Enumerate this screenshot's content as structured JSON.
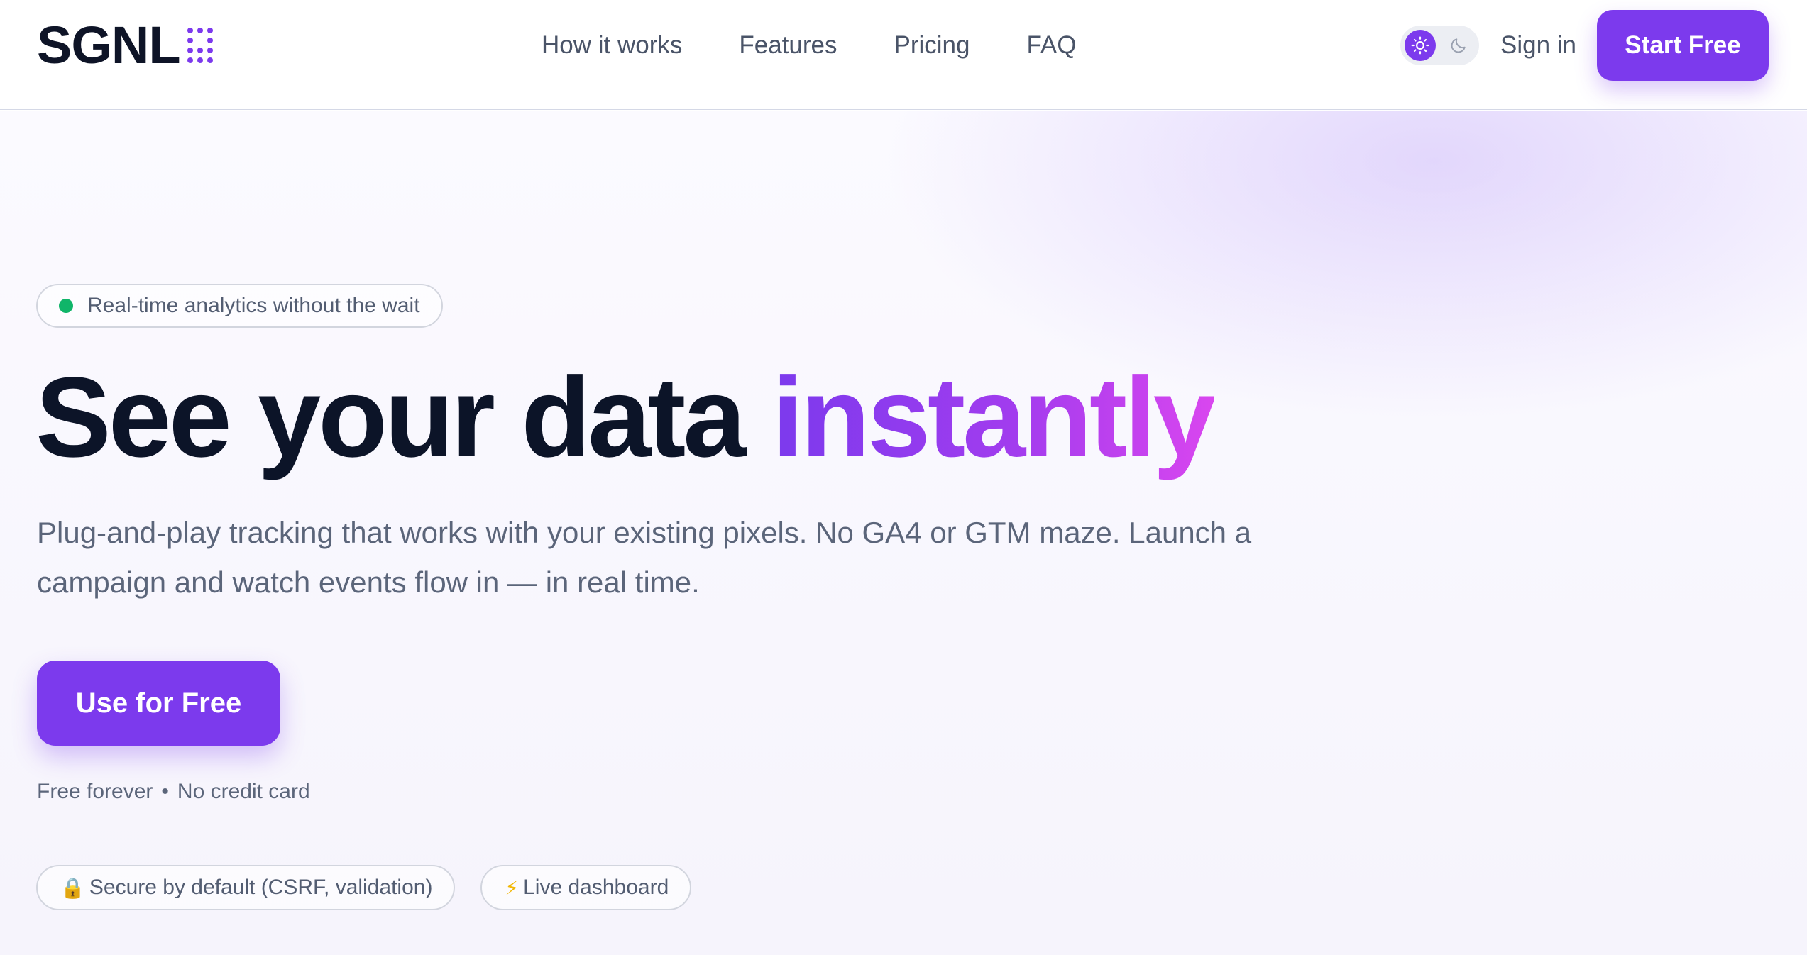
{
  "header": {
    "logo_text": "SGNL",
    "nav": [
      {
        "label": "How it works"
      },
      {
        "label": "Features"
      },
      {
        "label": "Pricing"
      },
      {
        "label": "FAQ"
      }
    ],
    "theme_toggle": {
      "active": "light",
      "icons": [
        "sun-icon",
        "moon-icon"
      ]
    },
    "sign_in_label": "Sign in",
    "start_free_label": "Start Free"
  },
  "hero": {
    "badge_text": "Real-time analytics without the wait",
    "headline_main": "See your data ",
    "headline_accent": "instantly",
    "subtext": "Plug-and-play tracking that works with your existing pixels. No GA4 or GTM maze. Launch a campaign and watch events flow in — in real time.",
    "cta_label": "Use for Free",
    "cta_note_left": "Free forever",
    "cta_note_sep": "•",
    "cta_note_right": "No credit card",
    "chips": [
      {
        "icon": "lock-icon",
        "glyph": "🔒",
        "label": "Secure by default (CSRF, validation)"
      },
      {
        "icon": "lightning-icon",
        "glyph": "⚡",
        "label": "Live dashboard"
      }
    ]
  },
  "colors": {
    "accent": "#7c3aed",
    "accent_gradient_end": "#d946ef",
    "headline": "#0c1428",
    "status_dot": "#10b569"
  }
}
